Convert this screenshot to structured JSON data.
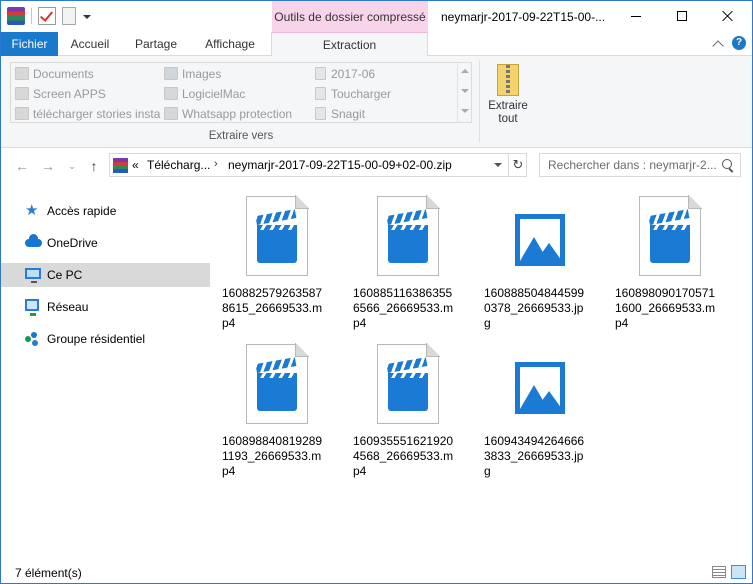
{
  "window": {
    "contextual_tab": "Outils de dossier compressé",
    "title": "neymarjr-2017-09-22T15-00-..."
  },
  "ribbon": {
    "tabs": [
      {
        "label": "Fichier"
      },
      {
        "label": "Accueil"
      },
      {
        "label": "Partage"
      },
      {
        "label": "Affichage"
      },
      {
        "label": "Extraction"
      }
    ],
    "gallery": [
      {
        "label": "Documents",
        "icon": "folder-icon"
      },
      {
        "label": "Screen APPS",
        "icon": "folder-icon"
      },
      {
        "label": "télécharger stories insta",
        "icon": "folder-icon"
      },
      {
        "label": "Images",
        "icon": "pictures-folder-icon"
      },
      {
        "label": "LogicielMac",
        "icon": "folder-icon"
      },
      {
        "label": "Whatsapp protection",
        "icon": "folder-icon"
      },
      {
        "label": "2017-06",
        "icon": "page-icon"
      },
      {
        "label": "Toucharger",
        "icon": "page-icon"
      },
      {
        "label": "Snagit",
        "icon": "page-icon"
      }
    ],
    "group_label": "Extraire vers",
    "extract_all": {
      "line1": "Extraire",
      "line2": "tout"
    }
  },
  "address": {
    "prefix": "«",
    "crumb1": "Télécharg...",
    "crumb2": "neymarjr-2017-09-22T15-00-09+02-00.zip",
    "search_placeholder": "Rechercher dans : neymarjr-2..."
  },
  "nav_pane": [
    {
      "label": "Accès rapide",
      "icon": "star-icon"
    },
    {
      "label": "OneDrive",
      "icon": "cloud-icon"
    },
    {
      "label": "Ce PC",
      "icon": "computer-icon",
      "selected": true
    },
    {
      "label": "Réseau",
      "icon": "network-icon"
    },
    {
      "label": "Groupe résidentiel",
      "icon": "homegroup-icon"
    }
  ],
  "files": [
    {
      "name": "160882579263587 8615_26669533.m p4",
      "type": "video"
    },
    {
      "name": "160885116386355 6566_26669533.m p4",
      "type": "video"
    },
    {
      "name": "160888504844599 0378_26669533.jp g",
      "type": "image"
    },
    {
      "name": "160898090170571 1600_26669533.m p4",
      "type": "video"
    },
    {
      "name": "160898840819289 1193_26669533.m p4",
      "type": "video"
    },
    {
      "name": "160935551621920 4568_26669533.m p4",
      "type": "video"
    },
    {
      "name": "160943494264666 3833_26669533.jp g",
      "type": "image"
    }
  ],
  "status": {
    "text": "7 élément(s)"
  },
  "colors": {
    "accent": "#1979ca",
    "contextual": "#f8d4ea",
    "file_icon": "#1b7ad3"
  }
}
